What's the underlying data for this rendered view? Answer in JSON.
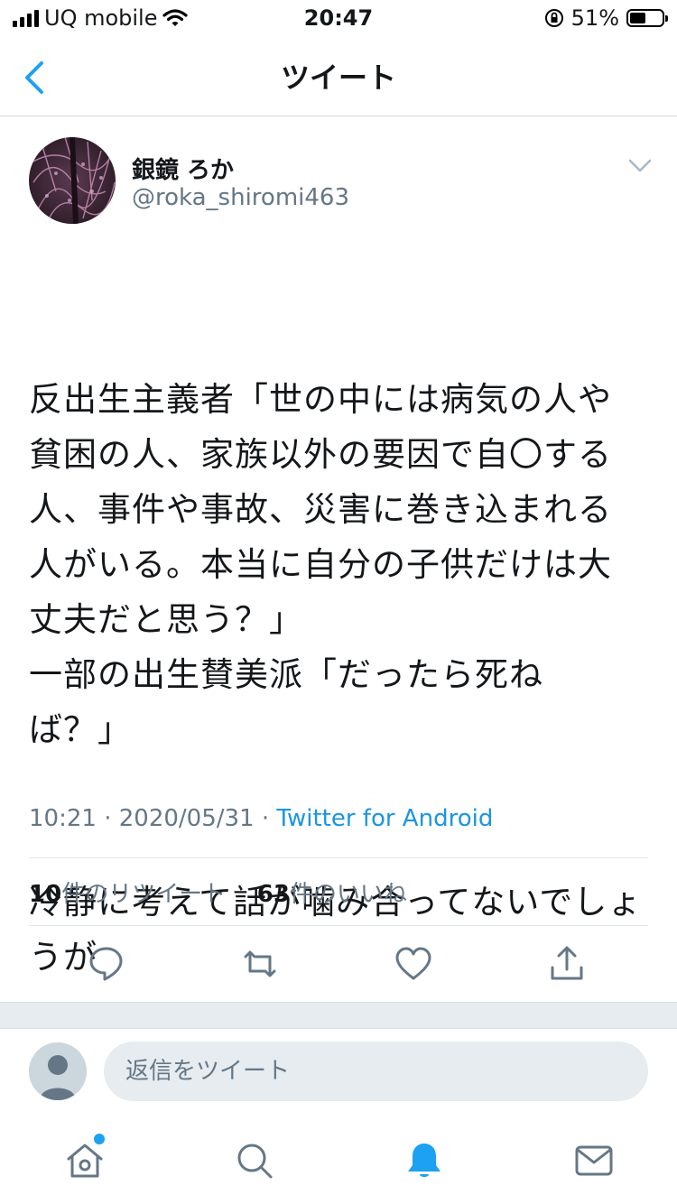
{
  "status_bar": {
    "carrier": "UQ mobile",
    "time": "20:47",
    "battery_percent": "51%",
    "battery_level": 0.51,
    "icons": [
      "signal-icon",
      "wifi-icon",
      "orientation-lock-icon",
      "battery-icon"
    ]
  },
  "nav": {
    "title": "ツイート",
    "back_icon": "chevron-left-icon"
  },
  "tweet": {
    "author_name": "銀鏡 ろか",
    "author_handle": "@roka_shiromi463",
    "text": "反出生主義者「世の中には病気の人や貧困の人、家族以外の要因で自〇する人、事件や事故、災害に巻き込まれる人がいる。本当に自分の子供だけは大丈夫だと思う？」\n一部の出生賛美派「だったら死ねば？」",
    "text2": "冷静に考えて話が噛み合ってないでしょうが",
    "time": "10:21",
    "date": "2020/05/31",
    "separator": " · ",
    "source": "Twitter for Android",
    "retweet_count": "10",
    "retweet_label": "件のリツイート",
    "like_count": "63",
    "like_label": "件のいいね"
  },
  "actions": [
    "reply-icon",
    "retweet-icon",
    "like-icon",
    "share-icon"
  ],
  "reply": {
    "placeholder": "返信をツイート"
  },
  "tab_bar": {
    "items": [
      "home-icon",
      "search-icon",
      "notifications-icon",
      "messages-icon"
    ],
    "active": "notifications-icon"
  },
  "colors": {
    "accent": "#1da1f2",
    "link": "#1b95e0",
    "secondary_text": "#657786",
    "divider": "#e1e8ed",
    "background_band": "#e6ecf0"
  }
}
